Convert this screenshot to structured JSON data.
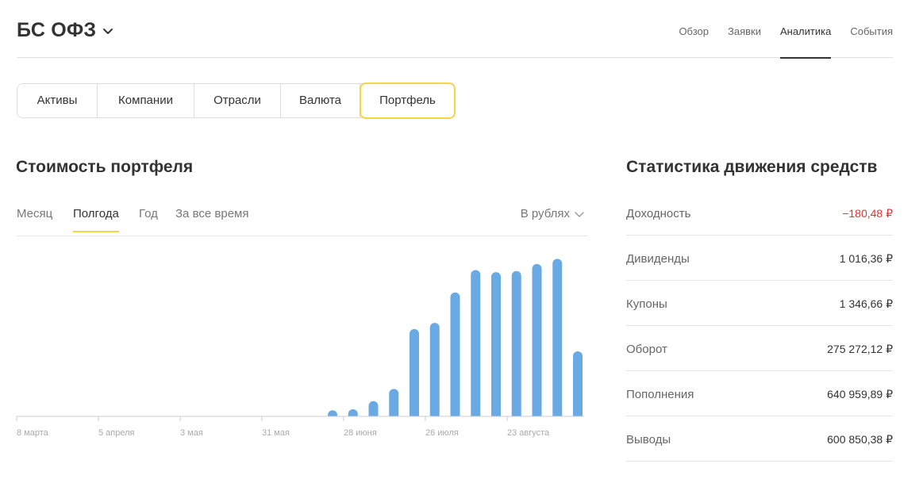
{
  "header": {
    "title": "БС ОФЗ",
    "nav": [
      {
        "label": "Обзор",
        "active": false
      },
      {
        "label": "Заявки",
        "active": false
      },
      {
        "label": "Аналитика",
        "active": true
      },
      {
        "label": "События",
        "active": false
      }
    ]
  },
  "analytics_tabs": [
    {
      "label": "Активы",
      "selected": false
    },
    {
      "label": "Компании",
      "selected": false
    },
    {
      "label": "Отрасли",
      "selected": false
    },
    {
      "label": "Валюта",
      "selected": false
    },
    {
      "label": "Портфель",
      "selected": true
    }
  ],
  "portfolio_value": {
    "title": "Стоимость портфеля",
    "periods": [
      {
        "label": "Месяц",
        "active": false
      },
      {
        "label": "Полгода",
        "active": true
      },
      {
        "label": "Год",
        "active": false
      },
      {
        "label": "За все время",
        "active": false
      }
    ],
    "currency_select": "В рублях"
  },
  "chart_data": {
    "type": "bar",
    "x_tick_labels": [
      "8 марта",
      "5 апреля",
      "3 мая",
      "31 мая",
      "28 июня",
      "26 июля",
      "23 августа"
    ],
    "values": [
      6,
      7,
      15,
      27,
      86,
      92,
      122,
      144,
      142,
      143,
      150,
      155,
      64
    ],
    "ylim": [
      0,
      160
    ],
    "grid": false,
    "bar_color": "#6aaae4"
  },
  "stats": {
    "title": "Статистика движения средств",
    "rows": [
      {
        "label": "Доходность",
        "value": "−180,48 ₽",
        "negative": true
      },
      {
        "label": "Дивиденды",
        "value": "1 016,36 ₽",
        "negative": false
      },
      {
        "label": "Купоны",
        "value": "1 346,66 ₽",
        "negative": false
      },
      {
        "label": "Оборот",
        "value": "275 272,12 ₽",
        "negative": false
      },
      {
        "label": "Пополнения",
        "value": "640 959,89 ₽",
        "negative": false
      },
      {
        "label": "Выводы",
        "value": "600 850,38 ₽",
        "negative": false
      }
    ],
    "negative_color": "#dd3333"
  },
  "icons": {
    "title_dropdown": "chevron-down-icon",
    "currency_dropdown": "chevron-down-icon"
  }
}
